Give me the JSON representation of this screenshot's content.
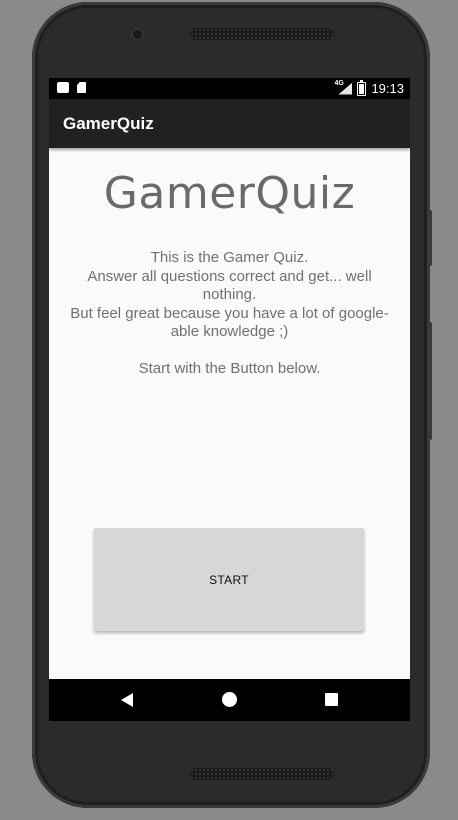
{
  "status_bar": {
    "network": "4G",
    "time": "19:13",
    "icons": [
      "notification-icon",
      "sd-card-icon",
      "signal-icon",
      "battery-icon"
    ]
  },
  "app_bar": {
    "title": "GamerQuiz"
  },
  "main": {
    "heading": "GamerQuiz",
    "description_lines": [
      "This is the Gamer Quiz.",
      "Answer all questions correct and get... well nothing.",
      "But feel great because you have a lot of google-able knowledge ;)",
      "",
      "Start with the Button below."
    ],
    "start_button_label": "START"
  },
  "nav_bar": {
    "icons": [
      "back-icon",
      "home-icon",
      "recents-icon"
    ]
  },
  "colors": {
    "app_bar": "#212121",
    "screen_background": "#fafafa",
    "button_background": "#d6d7d7",
    "text_gray": "#707070"
  }
}
